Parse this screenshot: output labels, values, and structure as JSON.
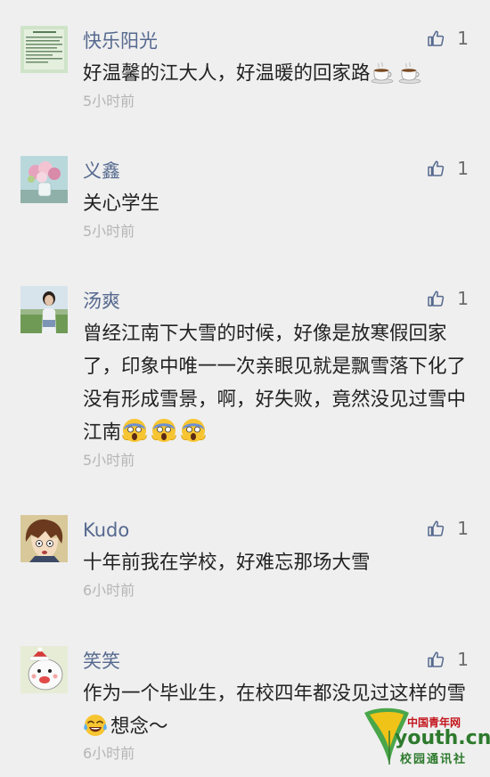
{
  "comments": [
    {
      "user": "快乐阳光",
      "text": "好温馨的江大人，好温暖的回家路",
      "time": "5小时前",
      "likes": "1",
      "emoji": [
        "coffee",
        "coffee"
      ],
      "avatar_icon": "document-thumbnail-avatar"
    },
    {
      "user": "义鑫",
      "text": "关心学生",
      "time": "5小时前",
      "likes": "1",
      "emoji": [],
      "avatar_icon": "flower-vase-avatar"
    },
    {
      "user": "汤爽",
      "text": "曾经江南下大雪的时候，好像是放寒假回家了，印象中唯一一次亲眼见就是飘雪落下化了没有形成雪景，啊，好失败，竟然没见过雪中江南",
      "time": "5小时前",
      "likes": "1",
      "emoji": [
        "scream",
        "scream",
        "scream"
      ],
      "avatar_icon": "person-photo-avatar"
    },
    {
      "user": "Kudo",
      "text": "十年前我在学校，好难忘那场大雪",
      "time": "6小时前",
      "likes": "1",
      "emoji": [],
      "avatar_icon": "anime-character-avatar"
    },
    {
      "user": "笑笑",
      "text_before": "作为一个毕业生，在校四年都没见过这样的雪",
      "text_after": "想念～",
      "time": "6小时前",
      "likes": "1",
      "emoji": [
        "tears-of-joy"
      ],
      "avatar_icon": "cartoon-bird-avatar"
    }
  ],
  "watermark": {
    "brand": "中国青年网",
    "domain": "youth.cn",
    "subtitle": "校园通讯社"
  },
  "colors": {
    "background": "#efefef",
    "username": "#56698f",
    "body_text": "#222222",
    "time_text": "#b5b5b5",
    "like_icon": "#56698f"
  }
}
